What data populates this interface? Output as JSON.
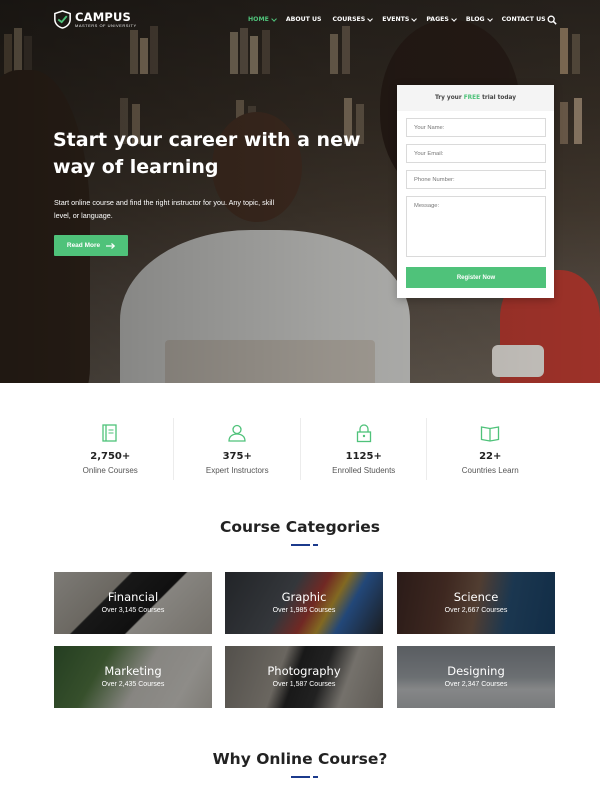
{
  "logo": {
    "title": "CAMPUS",
    "subtitle": "MASTERS OF UNIVERSITY"
  },
  "nav": {
    "items": [
      {
        "label": "HOME",
        "active": true,
        "dropdown": true
      },
      {
        "label": "ABOUT US",
        "active": false,
        "dropdown": false
      },
      {
        "label": "COURSES",
        "active": false,
        "dropdown": true
      },
      {
        "label": "EVENTS",
        "active": false,
        "dropdown": true
      },
      {
        "label": "PAGES",
        "active": false,
        "dropdown": true
      },
      {
        "label": "BLOG",
        "active": false,
        "dropdown": true
      },
      {
        "label": "CONTACT US",
        "active": false,
        "dropdown": false
      }
    ],
    "search_icon": "search-icon"
  },
  "hero": {
    "title": "Start your career with a new way of learning",
    "subtitle": "Start online course and find the right instructor for you. Any topic, skill level, or language.",
    "button": "Read More"
  },
  "trial_form": {
    "heading_prefix": "Try your",
    "heading_highlight": "FREE",
    "heading_suffix": "trial today",
    "fields": [
      {
        "placeholder": "Your Name:"
      },
      {
        "placeholder": "Your Email:"
      },
      {
        "placeholder": "Phone Number:"
      },
      {
        "placeholder": "Message:"
      }
    ],
    "submit": "Register Now"
  },
  "stats": [
    {
      "icon": "book-icon",
      "value": "2,750+",
      "label": "Online Courses"
    },
    {
      "icon": "user-icon",
      "value": "375+",
      "label": "Expert Instructors"
    },
    {
      "icon": "lock-icon",
      "value": "1125+",
      "label": "Enrolled Students"
    },
    {
      "icon": "open-book-icon",
      "value": "22+",
      "label": "Countries Learn"
    }
  ],
  "categories_section": {
    "title": "Course Categories",
    "items": [
      {
        "name": "Financial",
        "count": "Over 3,145 Courses"
      },
      {
        "name": "Graphic",
        "count": "Over 1,985 Courses"
      },
      {
        "name": "Science",
        "count": "Over 2,667 Courses"
      },
      {
        "name": "Marketing",
        "count": "Over 2,435 Courses"
      },
      {
        "name": "Photography",
        "count": "Over 1,587 Courses"
      },
      {
        "name": "Designing",
        "count": "Over 2,347 Courses"
      }
    ]
  },
  "why_section": {
    "title": "Why Online Course?"
  },
  "colors": {
    "accent": "#4fc27a",
    "rule": "#1b3a8c",
    "text_dark": "#222222"
  }
}
